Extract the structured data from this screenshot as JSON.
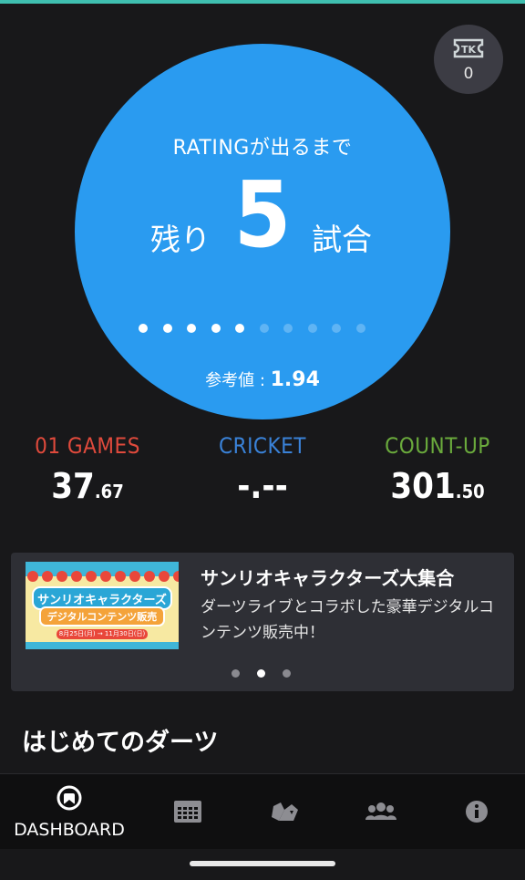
{
  "ticket": {
    "count": "0"
  },
  "rating": {
    "caption": "RATINGが出るまで",
    "left": "残り",
    "remaining": "5",
    "right": "試合",
    "progress": {
      "filled": 5,
      "total": 10
    },
    "reference_label": "参考値 : ",
    "reference_value": "1.94"
  },
  "stats": [
    {
      "label": "01 GAMES",
      "int": "37",
      "dec": ".67",
      "color": "#e04a3c"
    },
    {
      "label": "CRICKET",
      "int": "-.--",
      "dec": "",
      "color": "#3a82d8"
    },
    {
      "label": "COUNT-UP",
      "int": "301",
      "dec": ".50",
      "color": "#6aaa3c"
    }
  ],
  "banner": {
    "title": "サンリオキャラクターズ大集合",
    "text": "ダーツライブとコラボした豪華デジタルコンテンツ販売中！",
    "thumb_line1": "サンリオキャラクターズ",
    "thumb_line2": "デジタルコンテンツ販売",
    "thumb_date": "8月25日(月) → 11月30日(日)",
    "page": {
      "current": 2,
      "total": 3
    }
  },
  "section_title": "はじめてのダーツ",
  "nav": {
    "dashboard_label": "DASHBOARD",
    "icons": [
      "dashboard-icon",
      "calendar-icon",
      "map-icon",
      "friends-icon",
      "info-icon"
    ]
  },
  "colors": {
    "accent": "#2a9bf0",
    "background": "#18181a",
    "topline": "#3fbfb0"
  }
}
